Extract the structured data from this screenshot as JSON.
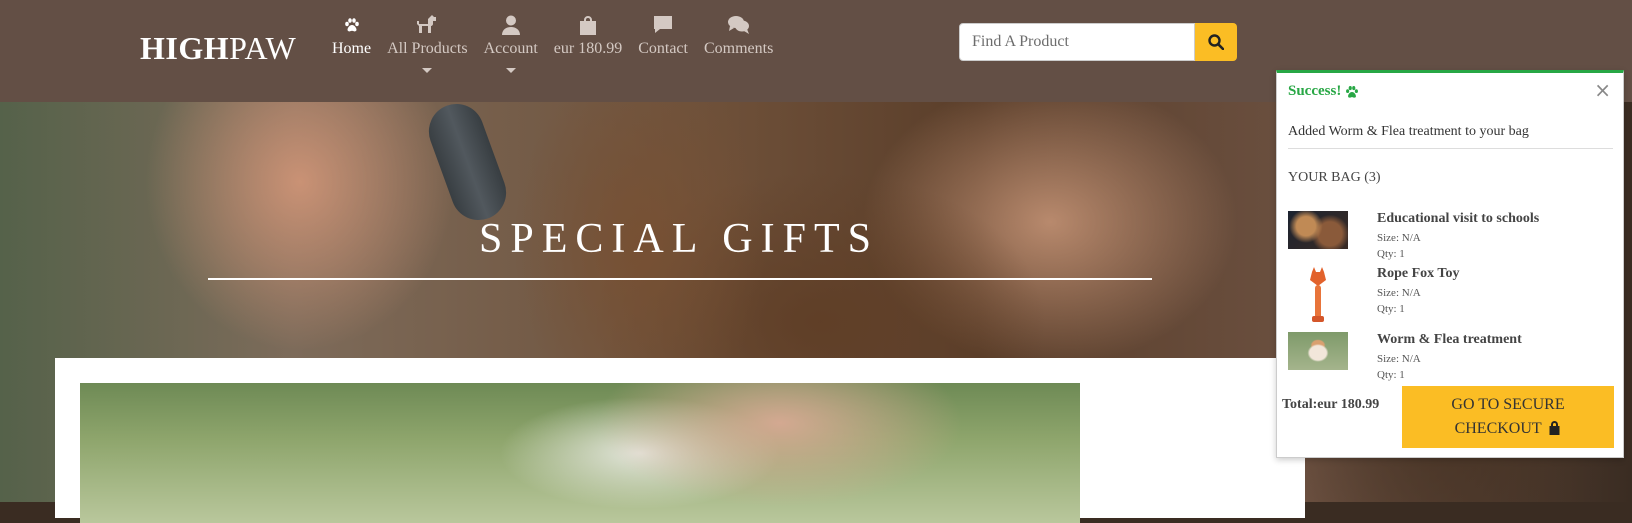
{
  "brand": {
    "bold": "HIGH",
    "light": "PAW"
  },
  "nav": {
    "items": [
      {
        "label": "Home",
        "icon": "paw-icon",
        "active": true,
        "dropdown": false
      },
      {
        "label": "All Products",
        "icon": "dog-icon",
        "active": false,
        "dropdown": true
      },
      {
        "label": "Account",
        "icon": "user-icon",
        "active": false,
        "dropdown": true
      },
      {
        "label": "eur 180.99",
        "icon": "shopping-bag-icon",
        "active": false,
        "dropdown": false
      },
      {
        "label": "Contact",
        "icon": "comment-icon",
        "active": false,
        "dropdown": false
      },
      {
        "label": "Comments",
        "icon": "comments-icon",
        "active": false,
        "dropdown": false
      }
    ]
  },
  "search": {
    "placeholder": "Find A Product",
    "value": ""
  },
  "hero": {
    "title": "SPECIAL GIFTS"
  },
  "bag": {
    "header": "Success!",
    "close": "×",
    "message": "Added Worm & Flea treatment to your bag",
    "count_label": "YOUR BAG (3)",
    "items": [
      {
        "name": "Educational visit to schools",
        "size": "Size: N/A",
        "qty": "Qty: 1"
      },
      {
        "name": "Rope Fox Toy",
        "size": "Size: N/A",
        "qty": "Qty: 1"
      },
      {
        "name": "Worm & Flea treatment",
        "size": "Size: N/A",
        "qty": "Qty: 1"
      }
    ],
    "total": "Total:eur 180.99",
    "checkout_line1": "GO TO SECURE",
    "checkout_line2": "CHECKOUT"
  },
  "colors": {
    "navbar": "#634f45",
    "accent": "#fbbd24",
    "success": "#28a745"
  }
}
